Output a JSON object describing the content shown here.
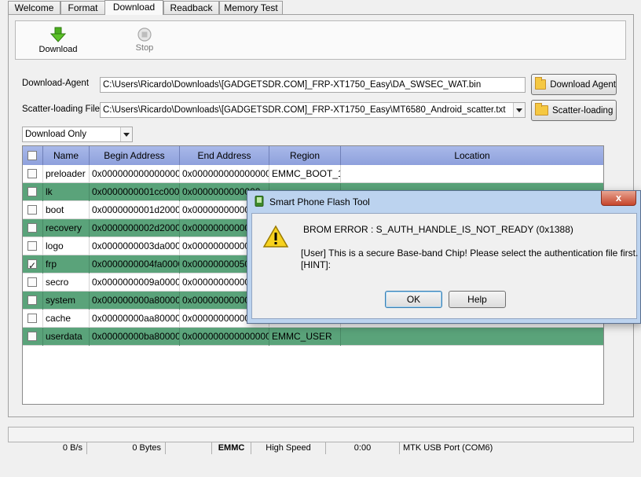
{
  "tabs": [
    "Welcome",
    "Format",
    "Download",
    "Readback",
    "Memory Test"
  ],
  "toolbar": {
    "download_label": "Download",
    "stop_label": "Stop"
  },
  "download_agent": {
    "label": "Download-Agent",
    "path": "C:\\Users\\Ricardo\\Downloads\\[GADGETSDR.COM]_FRP-XT1750_Easy\\DA_SWSEC_WAT.bin",
    "button": "Download Agent"
  },
  "scatter": {
    "label": "Scatter-loading File",
    "path": "C:\\Users\\Ricardo\\Downloads\\[GADGETSDR.COM]_FRP-XT1750_Easy\\MT6580_Android_scatter.txt",
    "button": "Scatter-loading"
  },
  "mode_select": "Download Only",
  "table": {
    "headers": [
      "Name",
      "Begin Address",
      "End Address",
      "Region",
      "Location"
    ],
    "rows": [
      {
        "name": "preloader",
        "begin": "0x0000000000000000",
        "end": "0x0000000000000000",
        "region": "EMMC_BOOT_1",
        "checked": false,
        "highlight": false
      },
      {
        "name": "lk",
        "begin": "0x0000000001cc0000",
        "end": "0x0000000000000",
        "region": "",
        "checked": false,
        "highlight": true
      },
      {
        "name": "boot",
        "begin": "0x0000000001d20000",
        "end": "0x000000000000",
        "region": "",
        "checked": false,
        "highlight": false
      },
      {
        "name": "recovery",
        "begin": "0x0000000002d20000",
        "end": "0x000000000000",
        "region": "",
        "checked": false,
        "highlight": true
      },
      {
        "name": "logo",
        "begin": "0x0000000003da0000",
        "end": "0x000000000000",
        "region": "",
        "checked": false,
        "highlight": false
      },
      {
        "name": "frp",
        "begin": "0x0000000004fa0000",
        "end": "0x000000000509",
        "region": "",
        "checked": true,
        "highlight": true
      },
      {
        "name": "secro",
        "begin": "0x0000000009a00000",
        "end": "0x000000000000",
        "region": "",
        "checked": false,
        "highlight": false
      },
      {
        "name": "system",
        "begin": "0x000000000a800000",
        "end": "0x000000000000",
        "region": "",
        "checked": false,
        "highlight": true
      },
      {
        "name": "cache",
        "begin": "0x00000000aa800000",
        "end": "0x000000000000",
        "region": "",
        "checked": false,
        "highlight": false
      },
      {
        "name": "userdata",
        "begin": "0x00000000ba800000",
        "end": "0x0000000000000000",
        "region": "EMMC_USER",
        "checked": false,
        "highlight": true
      }
    ]
  },
  "dialog": {
    "title": "Smart Phone Flash Tool",
    "error": "BROM ERROR : S_AUTH_HANDLE_IS_NOT_READY (0x1388)",
    "message": "[User] This is a secure Base-band Chip! Please select the authentication file first.",
    "hint": "[HINT]:",
    "ok": "OK",
    "help": "Help",
    "close": "x"
  },
  "status": {
    "speed": "0 B/s",
    "bytes": "0 Bytes",
    "storage": "EMMC",
    "mode": "High Speed",
    "time": "0:00",
    "port": "MTK USB Port (COM6)"
  },
  "colors": {
    "row_highlight": "#5aa37a",
    "table_header": "#9aabe2",
    "dialog_frame": "#bcd3ef",
    "download_arrow": "#4caf1f"
  }
}
